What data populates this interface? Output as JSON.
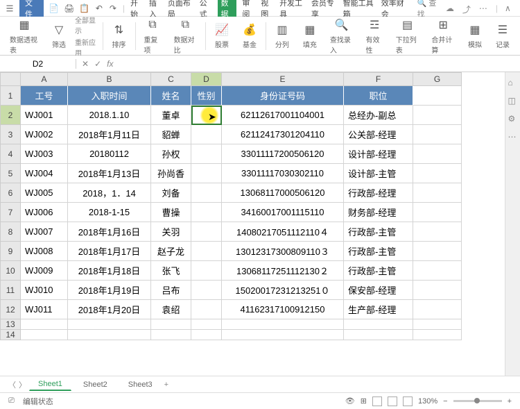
{
  "titlebar": {
    "file": "文件",
    "tabs": [
      "开始",
      "插入",
      "页面布局",
      "公式",
      "数据",
      "审阅",
      "视图",
      "开发工具",
      "会员专享",
      "智能工具箱",
      "效率财会"
    ],
    "active_tab_index": 4,
    "search": "查找"
  },
  "ribbon": {
    "g0": "数据透视表",
    "g0b": "筛选",
    "g1a": "全部显示",
    "g1b": "重新应用",
    "g2": "排序",
    "g3": "重复项",
    "g4": "数据对比",
    "g5": "股票",
    "g6": "基金",
    "g7": "分列",
    "g8": "填充",
    "g9": "查找录入",
    "g10": "有效性",
    "g11": "下拉列表",
    "g12": "合并计算",
    "g13": "模拟",
    "g14": "记录"
  },
  "namebox": {
    "ref": "D2",
    "fx": "fx"
  },
  "columns": [
    "A",
    "B",
    "C",
    "D",
    "E",
    "F",
    "G"
  ],
  "headers": [
    "工号",
    "入职时间",
    "姓名",
    "性别",
    "身份证号码",
    "职位"
  ],
  "rows": [
    {
      "n": "1"
    },
    {
      "n": "2",
      "a": "WJ001",
      "b": "2018.1.10",
      "c": "董卓",
      "d": "",
      "e": "62112617001104001",
      "f": "总经办-副总"
    },
    {
      "n": "3",
      "a": "WJ002",
      "b": "2018年1月11日",
      "c": "貂蝉",
      "d": "",
      "e": "62112417301204110",
      "f": "公关部-经理"
    },
    {
      "n": "4",
      "a": "WJ003",
      "b": "20180112",
      "c": "孙权",
      "d": "",
      "e": "33011117200506120",
      "f": "设计部-经理"
    },
    {
      "n": "5",
      "a": "WJ004",
      "b": "2018年1月13日",
      "c": "孙尚香",
      "d": "",
      "e": "33011117030302110",
      "f": "设计部-主管"
    },
    {
      "n": "6",
      "a": "WJ005",
      "b": "2018，1．14",
      "c": "刘备",
      "d": "",
      "e": "13068117000506120",
      "f": "行政部-经理"
    },
    {
      "n": "7",
      "a": "WJ006",
      "b": "2018-1-15",
      "c": "曹操",
      "d": "",
      "e": "34160017001115110",
      "f": "财务部-经理"
    },
    {
      "n": "8",
      "a": "WJ007",
      "b": "2018年1月16日",
      "c": "关羽",
      "d": "",
      "e": "14080217051112110４",
      "f": "行政部-主管"
    },
    {
      "n": "9",
      "a": "WJ008",
      "b": "2018年1月17日",
      "c": "赵子龙",
      "d": "",
      "e": "13012317300809110３",
      "f": "行政部-主管"
    },
    {
      "n": "10",
      "a": "WJ009",
      "b": "2018年1月18日",
      "c": "张飞",
      "d": "",
      "e": "13068117251112130２",
      "f": "行政部-主管"
    },
    {
      "n": "11",
      "a": "WJ010",
      "b": "2018年1月19日",
      "c": "吕布",
      "d": "",
      "e": "15020017231213251０",
      "f": "保安部-经理"
    },
    {
      "n": "12",
      "a": "WJ011",
      "b": "2018年1月20日",
      "c": "袁绍",
      "d": "",
      "e": "41162317100912150",
      "f": "生产部-经理"
    },
    {
      "n": "13"
    },
    {
      "n": "14"
    }
  ],
  "sheets": {
    "items": [
      "Sheet1",
      "Sheet2",
      "Sheet3"
    ],
    "active": 0
  },
  "statusbar": {
    "mode": "编辑状态",
    "zoom": "130%"
  },
  "chart_data": {
    "type": "table",
    "columns": [
      "工号",
      "入职时间",
      "姓名",
      "性别",
      "身份证号码",
      "职位"
    ],
    "rows": [
      [
        "WJ001",
        "2018.1.10",
        "董卓",
        "",
        "62112617001104001",
        "总经办-副总"
      ],
      [
        "WJ002",
        "2018年1月11日",
        "貂蝉",
        "",
        "62112417301204110",
        "公关部-经理"
      ],
      [
        "WJ003",
        "20180112",
        "孙权",
        "",
        "33011117200506120",
        "设计部-经理"
      ],
      [
        "WJ004",
        "2018年1月13日",
        "孙尚香",
        "",
        "33011117030302110",
        "设计部-主管"
      ],
      [
        "WJ005",
        "2018，1．14",
        "刘备",
        "",
        "13068117000506120",
        "行政部-经理"
      ],
      [
        "WJ006",
        "2018-1-15",
        "曹操",
        "",
        "34160017001115110",
        "财务部-经理"
      ],
      [
        "WJ007",
        "2018年1月16日",
        "关羽",
        "",
        "140802170511121104",
        "行政部-主管"
      ],
      [
        "WJ008",
        "2018年1月17日",
        "赵子龙",
        "",
        "130123173008091103",
        "行政部-主管"
      ],
      [
        "WJ009",
        "2018年1月18日",
        "张飞",
        "",
        "130681172511121302",
        "行政部-主管"
      ],
      [
        "WJ010",
        "2018年1月19日",
        "吕布",
        "",
        "150200172312132510",
        "保安部-经理"
      ],
      [
        "WJ011",
        "2018年1月20日",
        "袁绍",
        "",
        "41162317100912150",
        "生产部-经理"
      ]
    ]
  }
}
